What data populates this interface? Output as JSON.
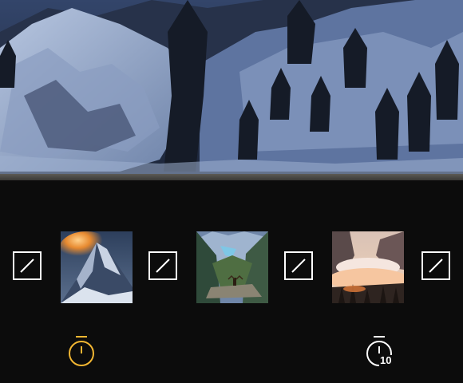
{
  "preview": {
    "image": "snowy-mountain-valley-at-dusk"
  },
  "transitions": [
    {
      "icon": "transition-slash-icon"
    },
    {
      "icon": "transition-slash-icon"
    },
    {
      "icon": "transition-slash-icon"
    },
    {
      "icon": "transition-slash-icon"
    }
  ],
  "clips": [
    {
      "image": "matterhorn-sunrise-peak"
    },
    {
      "image": "valley-lake-hiker"
    },
    {
      "image": "misty-canyon-sunset"
    }
  ],
  "timers": [
    {
      "icon": "stopwatch-icon",
      "value": "",
      "color": "#f2b632",
      "active": true
    },
    {
      "icon": "stopwatch-icon",
      "value": "10",
      "color": "#ffffff",
      "active": false
    }
  ],
  "colors": {
    "background": "#0c0c0c",
    "accent": "#f2b632",
    "icon": "#ffffff"
  }
}
